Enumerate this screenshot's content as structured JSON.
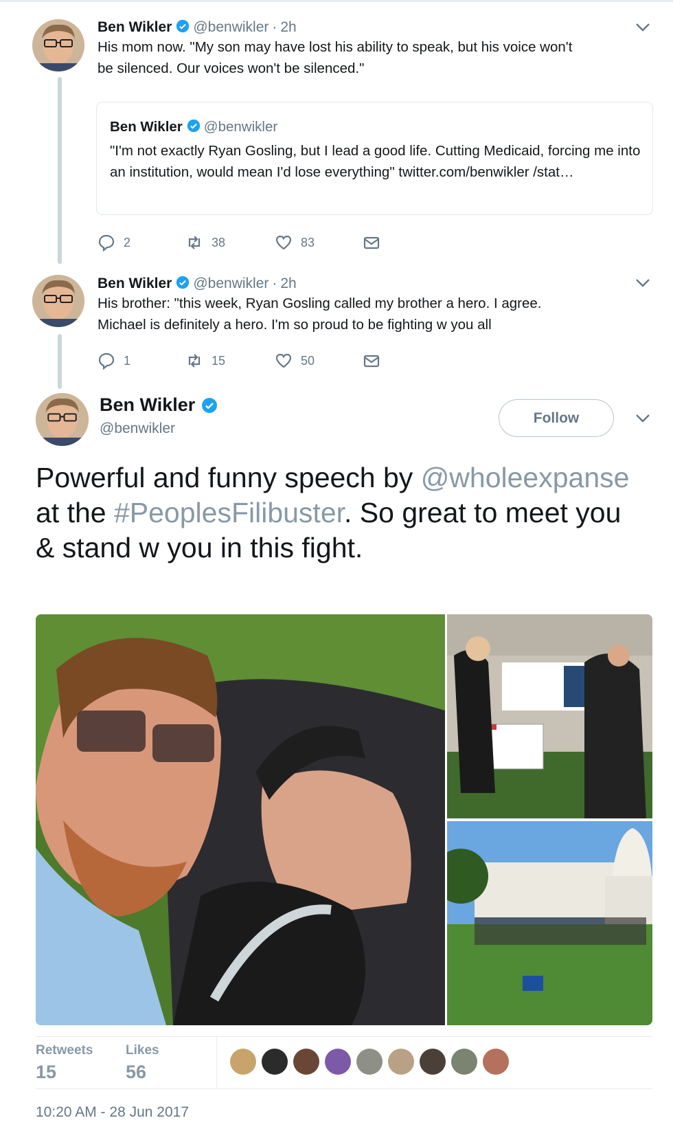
{
  "tweet1": {
    "name": "Ben Wikler",
    "handle": "@benwikler",
    "separator": "·",
    "time": "2h",
    "text_line1": "His mom now. \"My son may have lost his ability to speak, but his voice won't",
    "text_line2": "be silenced. Our voices won't be silenced.\"",
    "quote": {
      "name": "Ben Wikler",
      "handle": "@benwikler",
      "text": "\"I'm not exactly Ryan Gosling, but I lead a good life. Cutting Medicaid, forcing me into an institution, would mean I'd lose everything\" twitter.com/benwikler /stat…"
    },
    "actions": {
      "replies": "2",
      "retweets": "38",
      "likes": "83"
    }
  },
  "tweet2": {
    "name": "Ben Wikler",
    "handle": "@benwikler",
    "separator": "·",
    "time": "2h",
    "text_line1": "His brother: \"this week, Ryan Gosling called my brother a hero. I agree.",
    "text_line2": "Michael is definitely a hero. I'm so proud to be fighting w you all",
    "actions": {
      "replies": "1",
      "retweets": "15",
      "likes": "50"
    }
  },
  "main_tweet": {
    "name": "Ben Wikler",
    "handle": "@benwikler",
    "follow_label": "Follow",
    "text_part1": "Powerful and funny speech by ",
    "mention": "@wholeexpanse",
    "text_part2": " at the ",
    "hashtag": "#PeoplesFilibuster",
    "text_part3": ". So great to meet you & stand w you in this fight.",
    "retweets_label": "Retweets",
    "retweets": "15",
    "likes_label": "Likes",
    "likes": "56",
    "timestamp": "10:20 AM - 28 Jun 2017"
  },
  "colors": {
    "verified": "#1da1f2",
    "muted": "#657786",
    "link": "#8899a6"
  },
  "icons": [
    "caret-down-icon",
    "verified-badge-icon",
    "reply-icon",
    "retweet-icon",
    "like-icon",
    "direct-message-icon"
  ]
}
